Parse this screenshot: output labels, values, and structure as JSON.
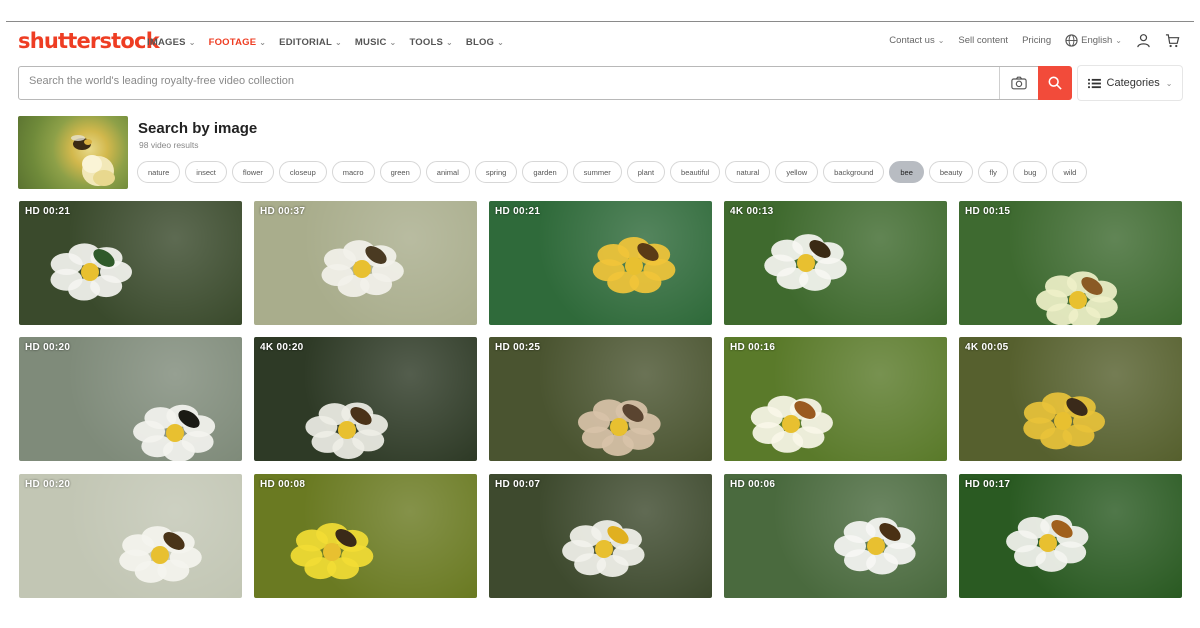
{
  "header": {
    "logo": "shutterstock",
    "nav": [
      {
        "label": "IMAGES",
        "active": false
      },
      {
        "label": "FOOTAGE",
        "active": true
      },
      {
        "label": "EDITORIAL",
        "active": false
      },
      {
        "label": "MUSIC",
        "active": false
      },
      {
        "label": "TOOLS",
        "active": false
      },
      {
        "label": "BLOG",
        "active": false
      }
    ],
    "contact": "Contact us",
    "sell": "Sell content",
    "pricing": "Pricing",
    "language": "English"
  },
  "search": {
    "placeholder": "Search the world's leading royalty-free video collection",
    "categories_label": "Categories"
  },
  "search_by_image": {
    "title": "Search by image",
    "result_count": "98 video results",
    "tags": [
      "nature",
      "insect",
      "flower",
      "closeup",
      "macro",
      "green",
      "animal",
      "spring",
      "garden",
      "summer",
      "plant",
      "beautiful",
      "natural",
      "yellow",
      "background",
      "bee",
      "beauty",
      "fly",
      "bug",
      "wild"
    ],
    "selected_tag": "bee"
  },
  "results": [
    {
      "badge": "HD 00:21",
      "bg": "#3a4a2c",
      "flower": "#f4f4f0",
      "insect": "#2f5a2a"
    },
    {
      "badge": "HD 00:37",
      "bg": "#a9ad8c",
      "flower": "#f2f1ea",
      "insect": "#4a3a22"
    },
    {
      "badge": "HD 00:21",
      "bg": "#2f6a3a",
      "flower": "#f1c43a",
      "insect": "#5a3a16"
    },
    {
      "badge": "4K 00:13",
      "bg": "#3f6a2e",
      "flower": "#f6f6f2",
      "insect": "#3a2a14"
    },
    {
      "badge": "HD 00:15",
      "bg": "#3e6a30",
      "flower": "#eef0c8",
      "insect": "#8a5a24"
    },
    {
      "badge": "HD 00:20",
      "bg": "#7f8b7a",
      "flower": "#f3f3ef",
      "insect": "#1a1a14"
    },
    {
      "badge": "4K 00:20",
      "bg": "#2e3a26",
      "flower": "#eeeee6",
      "insect": "#4a3218"
    },
    {
      "badge": "HD 00:25",
      "bg": "#4a5430",
      "flower": "#d8c2a8",
      "insect": "#5a4430"
    },
    {
      "badge": "HD 00:16",
      "bg": "#5a7a2a",
      "flower": "#f8f6e8",
      "insect": "#9a5a20"
    },
    {
      "badge": "4K 00:05",
      "bg": "#56602e",
      "flower": "#e8c23a",
      "insect": "#3a2a1a"
    },
    {
      "badge": "HD 00:20",
      "bg": "#c2c6b4",
      "flower": "#f4f4ee",
      "insect": "#4a3418"
    },
    {
      "badge": "HD 00:08",
      "bg": "#6a7a22",
      "flower": "#f2dc34",
      "insect": "#3a2a18"
    },
    {
      "badge": "HD 00:07",
      "bg": "#3e4a2e",
      "flower": "#f2f2ec",
      "insect": "#e0b020"
    },
    {
      "badge": "HD 00:06",
      "bg": "#4a6a3e",
      "flower": "#f6f6f4",
      "insect": "#4a3014"
    },
    {
      "badge": "HD 00:17",
      "bg": "#2a5a22",
      "flower": "#f4f4f0",
      "insect": "#a0601c"
    }
  ]
}
